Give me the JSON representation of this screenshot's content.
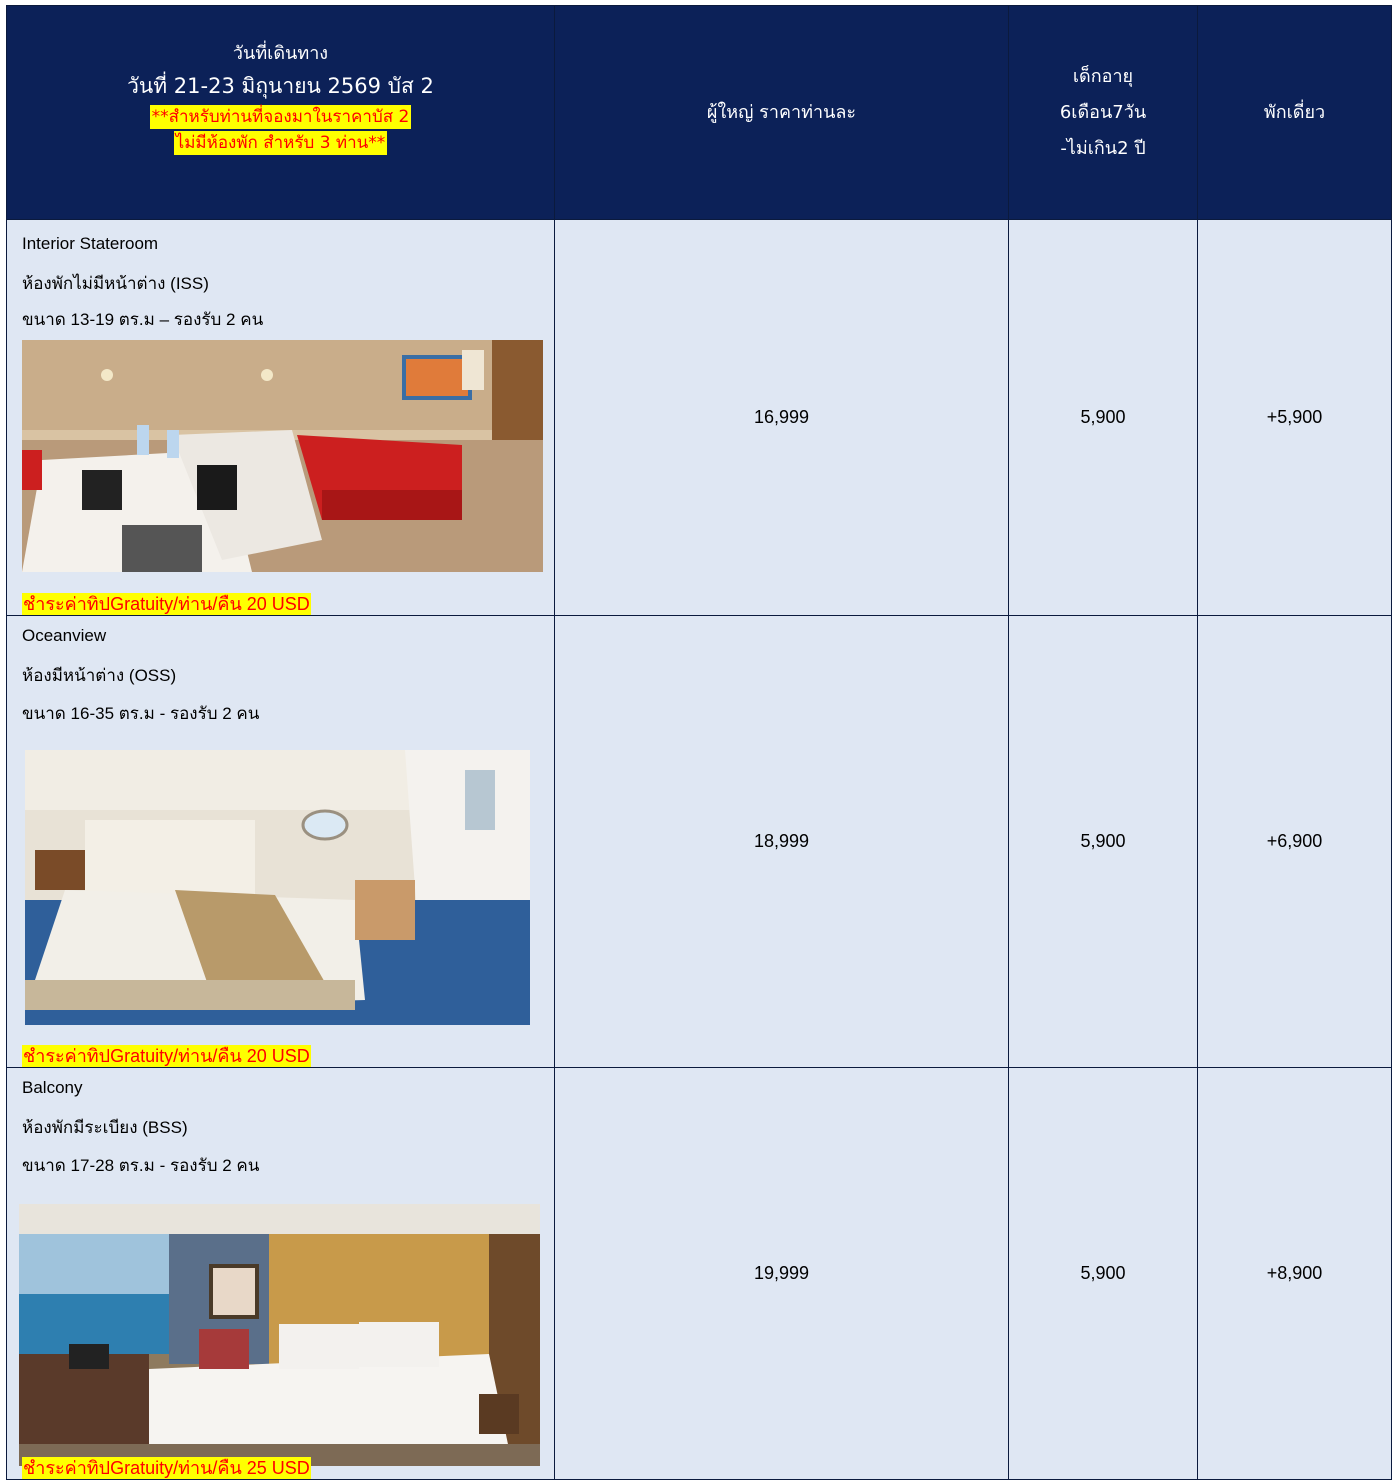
{
  "header": {
    "travel_label": "วันที่เดินทาง",
    "travel_date": "วันที่ 21-23 มิถุนายน 2569  บัส 2",
    "note_line1": "**สำหรับท่านที่จองมาในราคาบัส 2",
    "note_line2": "ไม่มีห้องพัก สำหรับ 3 ท่าน**",
    "adult": "ผู้ใหญ่ ราคาท่านละ",
    "child_line1": "เด็กอายุ",
    "child_line2": "6เดือน7วัน",
    "child_line3": "-ไม่เกิน2 ปี",
    "single": "พักเดี่ยว"
  },
  "rooms": [
    {
      "name_en": "Interior Stateroom",
      "name_th": "ห้องพักไม่มีหน้าต่าง (ISS)",
      "size": "ขนาด 13-19 ตร.ม – รองรับ 2 คน",
      "tip": "ชำระค่าทิปGratuity/ท่าน/คืน 20 USD",
      "adult_price": "16,999",
      "child_price": "5,900",
      "single_supplement": "+5,900"
    },
    {
      "name_en": "Oceanview",
      "name_th": "ห้องมีหน้าต่าง (OSS)",
      "size": "ขนาด 16-35 ตร.ม - รองรับ 2 คน",
      "tip": "ชำระค่าทิปGratuity/ท่าน/คืน 20 USD",
      "adult_price": "18,999",
      "child_price": "5,900",
      "single_supplement": "+6,900"
    },
    {
      "name_en": "Balcony",
      "name_th": "ห้องพักมีระเบียง (BSS)",
      "size": "ขนาด 17-28 ตร.ม - รองรับ 2 คน",
      "tip": "ชำระค่าทิปGratuity/ท่าน/คืน 25 USD",
      "adult_price": "19,999",
      "child_price": "5,900",
      "single_supplement": "+8,900"
    }
  ],
  "colors": {
    "header_bg": "#0c2158",
    "body_bg": "#dfe7f3",
    "highlight": "#ffff00",
    "highlight_text": "#ff0000"
  }
}
